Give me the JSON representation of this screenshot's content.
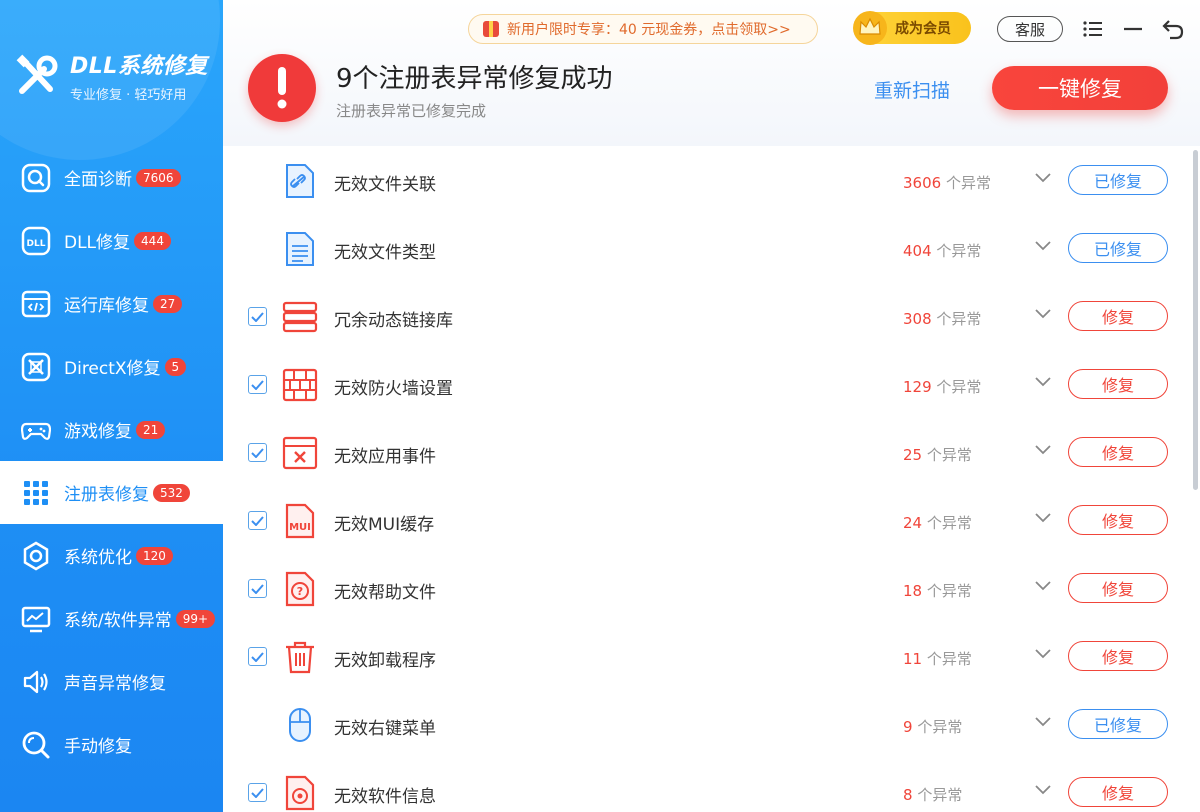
{
  "app": {
    "title": "DLL系统修复",
    "subtitle": "专业修复 · 轻巧好用"
  },
  "sidebar": {
    "items": [
      {
        "label": "全面诊断",
        "badge": "7606",
        "icon": "search-icon"
      },
      {
        "label": "DLL修复",
        "badge": "444",
        "icon": "dll-file-icon"
      },
      {
        "label": "运行库修复",
        "badge": "27",
        "icon": "runtime-icon"
      },
      {
        "label": "DirectX修复",
        "badge": "5",
        "icon": "directx-icon"
      },
      {
        "label": "游戏修复",
        "badge": "21",
        "icon": "gamepad-icon"
      },
      {
        "label": "注册表修复",
        "badge": "532",
        "icon": "grid-icon",
        "active": true
      },
      {
        "label": "系统优化",
        "badge": "120",
        "icon": "optimize-icon"
      },
      {
        "label": "系统/软件异常",
        "badge": "99+",
        "icon": "monitor-icon"
      },
      {
        "label": "声音异常修复",
        "badge": "",
        "icon": "speaker-icon"
      },
      {
        "label": "手动修复",
        "badge": "",
        "icon": "manual-search-icon"
      }
    ]
  },
  "topbar": {
    "promo": "新用户限时专享：40 元现金券，点击领取>>",
    "vip": "成为会员",
    "service": "客服"
  },
  "header": {
    "title": "9个注册表异常修复成功",
    "subtitle": "注册表异常已修复完成",
    "rescan": "重新扫描",
    "fix_all": "一键修复"
  },
  "list": {
    "unit": "个异常",
    "rows": [
      {
        "name": "无效文件关联",
        "count": "3606",
        "status": "已修复",
        "checkbox": false,
        "icon": "file-link-icon"
      },
      {
        "name": "无效文件类型",
        "count": "404",
        "status": "已修复",
        "checkbox": false,
        "icon": "document-icon"
      },
      {
        "name": "冗余动态链接库",
        "count": "308",
        "status": "修复",
        "checkbox": true,
        "icon": "server-stack-icon"
      },
      {
        "name": "无效防火墙设置",
        "count": "129",
        "status": "修复",
        "checkbox": true,
        "icon": "firewall-icon"
      },
      {
        "name": "无效应用事件",
        "count": "25",
        "status": "修复",
        "checkbox": true,
        "icon": "app-error-icon"
      },
      {
        "name": "无效MUI缓存",
        "count": "24",
        "status": "修复",
        "checkbox": true,
        "icon": "mui-file-icon"
      },
      {
        "name": "无效帮助文件",
        "count": "18",
        "status": "修复",
        "checkbox": true,
        "icon": "help-file-icon"
      },
      {
        "name": "无效卸载程序",
        "count": "11",
        "status": "修复",
        "checkbox": true,
        "icon": "trash-icon"
      },
      {
        "name": "无效右键菜单",
        "count": "9",
        "status": "已修复",
        "checkbox": false,
        "icon": "mouse-icon"
      },
      {
        "name": "无效软件信息",
        "count": "8",
        "status": "修复",
        "checkbox": true,
        "icon": "software-info-icon"
      }
    ]
  },
  "colors": {
    "accent_blue": "#1e8ff5",
    "danger_red": "#f0453a"
  }
}
